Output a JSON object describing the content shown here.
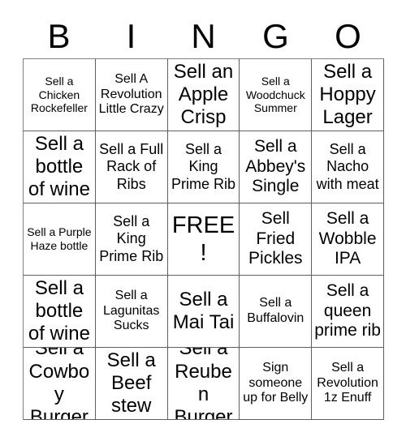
{
  "header": {
    "letters": [
      "B",
      "I",
      "N",
      "G",
      "O"
    ]
  },
  "grid": {
    "columns": 5,
    "rows": 5,
    "free_space": {
      "row": 2,
      "col": 2,
      "label": "FREE!"
    },
    "cells": [
      {
        "text": "Sell a Chicken Rockefeller",
        "size": "xs"
      },
      {
        "text": "Sell A Revolution Little Crazy",
        "size": "s"
      },
      {
        "text": "Sell an Apple Crisp",
        "size": "xl"
      },
      {
        "text": "Sell a Woodchuck Summer",
        "size": "xs"
      },
      {
        "text": "Sell a Hoppy Lager",
        "size": "xl"
      },
      {
        "text": "Sell a bottle of wine",
        "size": "xl"
      },
      {
        "text": "Sell a Full Rack of Ribs",
        "size": "m"
      },
      {
        "text": "Sell a King Prime Rib",
        "size": "m"
      },
      {
        "text": "Sell a Abbey's Single",
        "size": "l"
      },
      {
        "text": "Sell a Nacho with meat",
        "size": "m"
      },
      {
        "text": "Sell a Purple Haze bottle",
        "size": "xs"
      },
      {
        "text": "Sell a King Prime Rib",
        "size": "m"
      },
      {
        "text": "FREE!",
        "size": "free"
      },
      {
        "text": "Sell Fried Pickles",
        "size": "l"
      },
      {
        "text": "Sell a Wobble IPA",
        "size": "l"
      },
      {
        "text": "Sell a bottle of wine",
        "size": "xl"
      },
      {
        "text": "Sell a Lagunitas Sucks",
        "size": "s"
      },
      {
        "text": "Sell a Mai Tai",
        "size": "xl"
      },
      {
        "text": "Sell a Buffalovin",
        "size": "s"
      },
      {
        "text": "Sell a queen prime rib",
        "size": "l"
      },
      {
        "text": "Sell a Cowboy Burger",
        "size": "xl"
      },
      {
        "text": "Sell a Beef stew",
        "size": "xl"
      },
      {
        "text": "Sell a Reuben Burger",
        "size": "xl"
      },
      {
        "text": "Sign someone up for Belly",
        "size": "s"
      },
      {
        "text": "Sell a Revolution 1z Enuff",
        "size": "s"
      }
    ]
  },
  "colors": {
    "background": "#ffffff",
    "text": "#000000",
    "grid_line": "#606060"
  }
}
